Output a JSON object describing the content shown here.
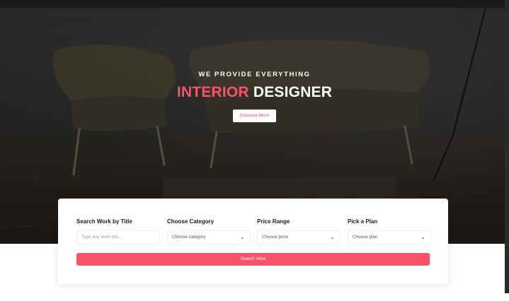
{
  "hero": {
    "kicker": "WE PROVIDE EVERYTHING",
    "headline_accent": "INTERIOR",
    "headline_rest": "DESIGNER",
    "discover_label": "Discover More"
  },
  "search": {
    "fields": [
      {
        "label": "Search Work by Title",
        "placeholder": "Type any work title..."
      },
      {
        "label": "Choose Category",
        "value": "Choose category"
      },
      {
        "label": "Price Range",
        "value": "Choose price"
      },
      {
        "label": "Pick a Plan",
        "value": "Choose plan"
      }
    ],
    "button_label": "Search Now"
  },
  "colors": {
    "accent": "#f7546a",
    "dark": "#1b1b1b"
  },
  "icons": {
    "dropdown": "chevron-down-icon"
  }
}
